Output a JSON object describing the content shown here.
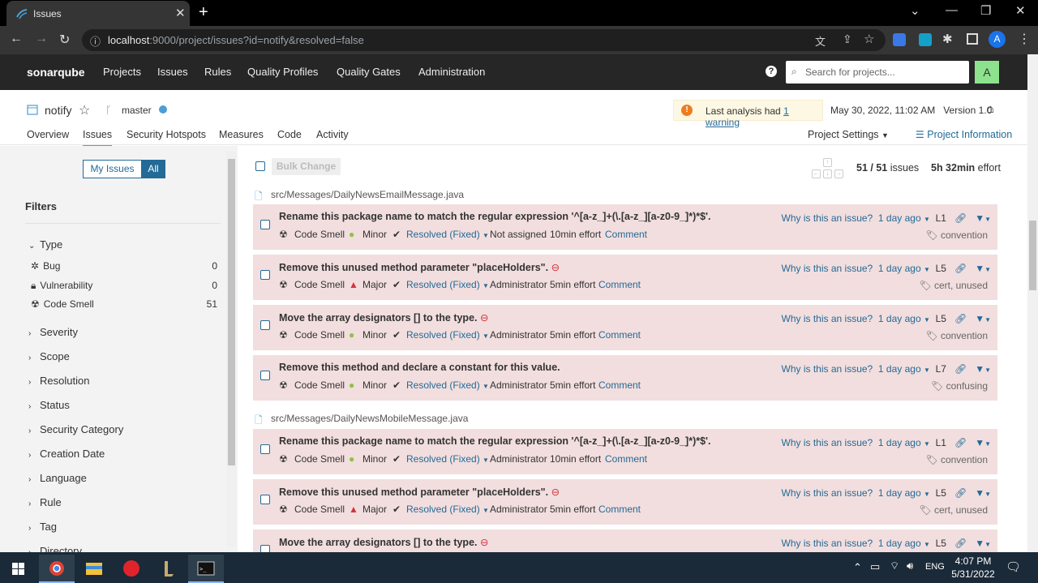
{
  "browser": {
    "tab_title": "Issues",
    "url_host": "localhost",
    "url_rest": ":9000/project/issues?id=notify&resolved=false",
    "profile_initial": "A"
  },
  "nav": {
    "logo": "sonarqube",
    "items": [
      "Projects",
      "Issues",
      "Rules",
      "Quality Profiles",
      "Quality Gates",
      "Administration"
    ],
    "search_placeholder": "Search for projects...",
    "user_initial": "A"
  },
  "project": {
    "name": "notify",
    "branch": "master",
    "warning_prefix": "Last analysis had ",
    "warning_link": "1 warning",
    "analysis_date": "May 30, 2022, 11:02 AM",
    "version": "Version 1.0",
    "tabs": [
      "Overview",
      "Issues",
      "Security Hotspots",
      "Measures",
      "Code",
      "Activity"
    ],
    "settings": "Project Settings",
    "info": "Project Information"
  },
  "sidebar": {
    "my_issues": "My Issues",
    "all": "All",
    "filters_title": "Filters",
    "type_title": "Type",
    "types": [
      {
        "label": "Bug",
        "count": "0"
      },
      {
        "label": "Vulnerability",
        "count": "0"
      },
      {
        "label": "Code Smell",
        "count": "51"
      }
    ],
    "sections": [
      "Severity",
      "Scope",
      "Resolution",
      "Status",
      "Security Category",
      "Creation Date",
      "Language",
      "Rule",
      "Tag",
      "Directory"
    ]
  },
  "main": {
    "bulk_change": "Bulk Change",
    "issues_count": "51 / 51",
    "issues_word": "issues",
    "effort_value": "5h 32min",
    "effort_word": "effort",
    "files": [
      {
        "path": "src/Messages/DailyNewsEmailMessage.java"
      },
      {
        "path": "src/Messages/DailyNewsMobileMessage.java"
      }
    ],
    "issues": [
      {
        "message": "Rename this package name to match the regular expression '^[a-z_]+(\\.[a-z_][a-z0-9_]*)*$'.",
        "type": "Code Smell",
        "severity": "Minor",
        "resolution": "Resolved (Fixed)",
        "assignee": "Not assigned",
        "effort": "10min effort",
        "comment": "Comment",
        "why": "Why is this an issue?",
        "age": "1 day ago",
        "line": "L1",
        "tags": "convention"
      },
      {
        "message": "Remove this unused method parameter \"placeHolders\".",
        "type": "Code Smell",
        "severity": "Major",
        "resolution": "Resolved (Fixed)",
        "assignee": "Administrator",
        "effort": "5min effort",
        "comment": "Comment",
        "why": "Why is this an issue?",
        "age": "1 day ago",
        "line": "L5",
        "tags": "cert, unused"
      },
      {
        "message": "Move the array designators [] to the type.",
        "type": "Code Smell",
        "severity": "Minor",
        "resolution": "Resolved (Fixed)",
        "assignee": "Administrator",
        "effort": "5min effort",
        "comment": "Comment",
        "why": "Why is this an issue?",
        "age": "1 day ago",
        "line": "L5",
        "tags": "convention"
      },
      {
        "message": "Remove this method and declare a constant for this value.",
        "type": "Code Smell",
        "severity": "Minor",
        "resolution": "Resolved (Fixed)",
        "assignee": "Administrator",
        "effort": "5min effort",
        "comment": "Comment",
        "why": "Why is this an issue?",
        "age": "1 day ago",
        "line": "L7",
        "tags": "confusing"
      },
      {
        "message": "Rename this package name to match the regular expression '^[a-z_]+(\\.[a-z_][a-z0-9_]*)*$'.",
        "type": "Code Smell",
        "severity": "Minor",
        "resolution": "Resolved (Fixed)",
        "assignee": "Administrator",
        "effort": "10min effort",
        "comment": "Comment",
        "why": "Why is this an issue?",
        "age": "1 day ago",
        "line": "L1",
        "tags": "convention"
      },
      {
        "message": "Remove this unused method parameter \"placeHolders\".",
        "type": "Code Smell",
        "severity": "Major",
        "resolution": "Resolved (Fixed)",
        "assignee": "Administrator",
        "effort": "5min effort",
        "comment": "Comment",
        "why": "Why is this an issue?",
        "age": "1 day ago",
        "line": "L5",
        "tags": "cert, unused"
      },
      {
        "message": "Move the array designators [] to the type.",
        "why": "Why is this an issue?",
        "age": "1 day ago",
        "line": "L5"
      }
    ]
  },
  "taskbar": {
    "lang": "ENG",
    "time": "4:07 PM",
    "date": "5/31/2022"
  },
  "colors": {
    "issue_bg": "#f2dede",
    "link_blue": "#236a97",
    "nav_bg": "#262626",
    "minor_green": "#8bc34a",
    "major_red": "#d4333f"
  }
}
